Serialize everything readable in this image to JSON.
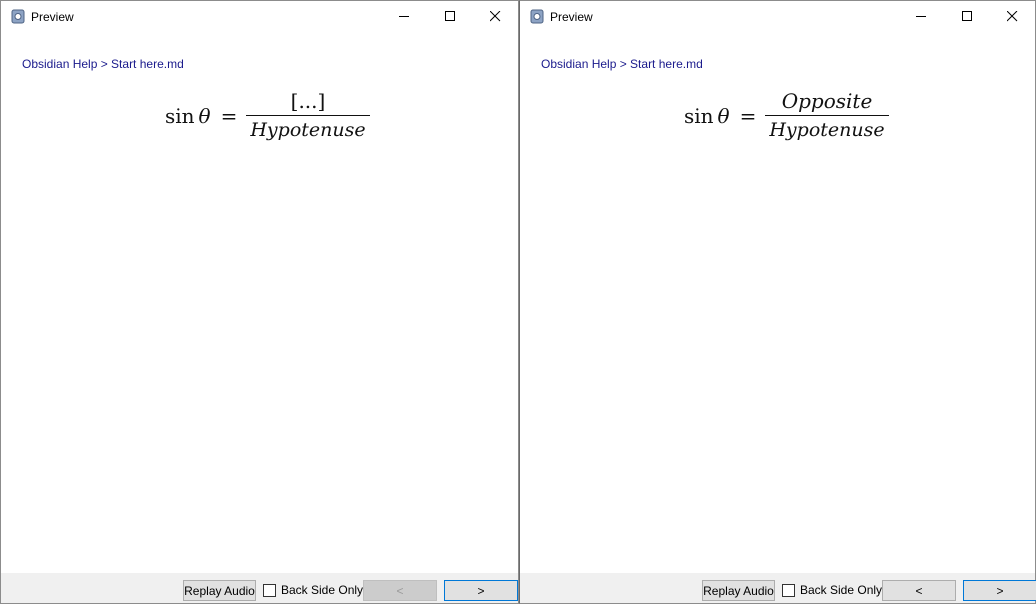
{
  "windows": [
    {
      "title": "Preview",
      "breadcrumb": "Obsidian Help > Start here.md",
      "formula": {
        "lhs_func": "sin",
        "lhs_var": "θ",
        "equals": "=",
        "numerator": "[...]",
        "denominator": "Hypotenuse"
      },
      "bottom": {
        "replay_label": "Replay Audio",
        "back_side_label": "Back Side Only",
        "back_side_checked": false,
        "prev_label": "<",
        "next_label": ">",
        "prev_disabled": true
      }
    },
    {
      "title": "Preview",
      "breadcrumb": "Obsidian Help > Start here.md",
      "formula": {
        "lhs_func": "sin",
        "lhs_var": "θ",
        "equals": "=",
        "numerator": "Opposite",
        "denominator": "Hypotenuse"
      },
      "bottom": {
        "replay_label": "Replay Audio",
        "back_side_label": "Back Side Only",
        "back_side_checked": false,
        "prev_label": "<",
        "next_label": ">",
        "prev_disabled": false
      }
    }
  ],
  "icons": {
    "minimize": "minimize-icon",
    "maximize": "maximize-icon",
    "close": "close-icon",
    "app": "app-icon"
  },
  "colors": {
    "breadcrumb": "#1a1a8c",
    "focus_border": "#0078d7",
    "bottom_bar": "#f0f0f0"
  }
}
